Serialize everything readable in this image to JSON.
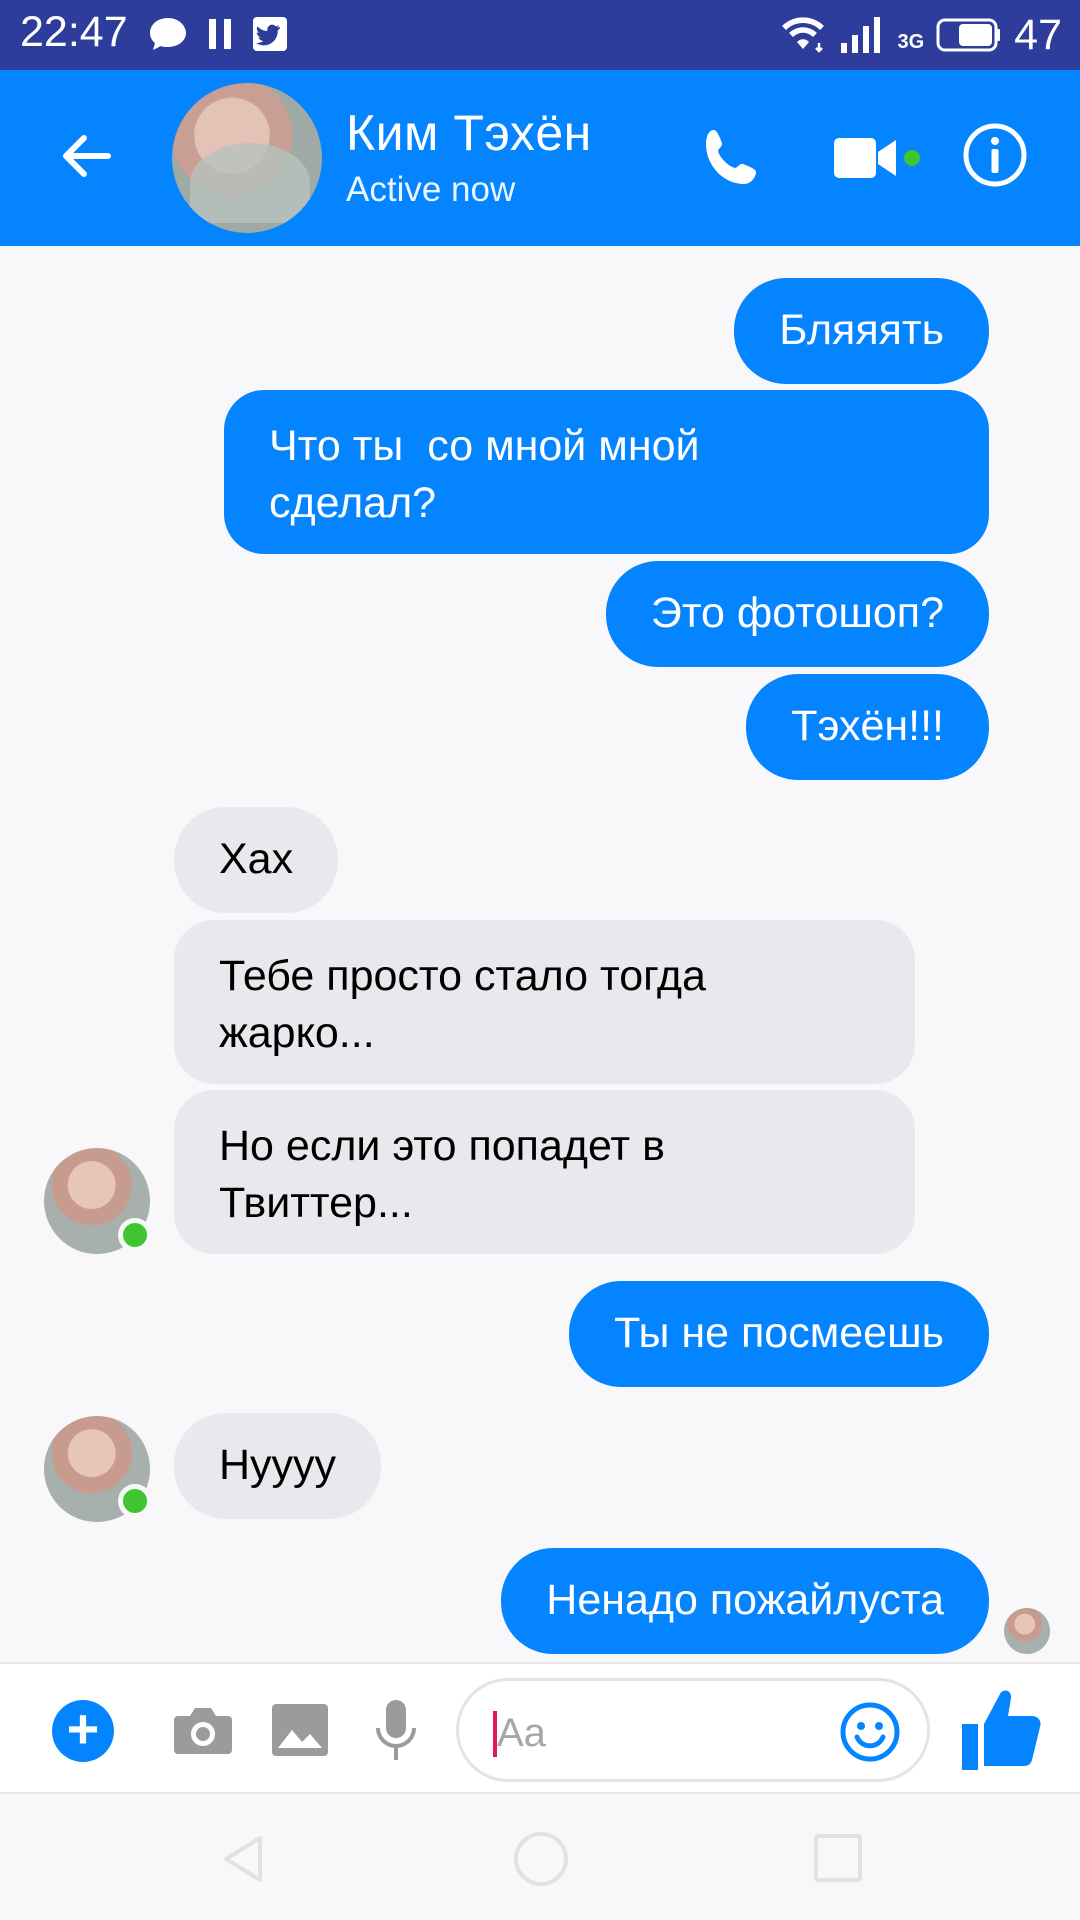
{
  "status_bar": {
    "time": "22:47",
    "network_label": "3G",
    "battery": "47",
    "icons": [
      "message-icon",
      "pause-icon",
      "twitter-icon",
      "wifi-icon",
      "signal-icon",
      "battery-icon"
    ]
  },
  "header": {
    "contact_name": "Ким Тэхён",
    "status": "Active now",
    "online_dot_color": "#3fc52f",
    "accent_color": "#0584ff",
    "icons": [
      "back-arrow-icon",
      "phone-icon",
      "video-camera-icon",
      "info-icon"
    ]
  },
  "messages": [
    {
      "direction": "out",
      "text": "Бляяять"
    },
    {
      "direction": "out",
      "text": "Что ты  со мной мной\nсделал?"
    },
    {
      "direction": "out",
      "text": "Это фотошоп?"
    },
    {
      "direction": "out",
      "text": "Тэхён!!!"
    },
    {
      "direction": "in",
      "text": "Хах"
    },
    {
      "direction": "in",
      "text": "Тебе просто стало тогда\nжарко..."
    },
    {
      "direction": "in",
      "text": "Но если это попадет в\nТвиттер..."
    },
    {
      "direction": "out",
      "text": "Ты не посмеешь"
    },
    {
      "direction": "in",
      "text": "Нуууу"
    },
    {
      "direction": "out",
      "text": "Ненадо пожайлуста"
    }
  ],
  "composer": {
    "placeholder": "Aa",
    "icons": [
      "plus-icon",
      "camera-icon",
      "image-icon",
      "microphone-icon",
      "emoji-icon",
      "thumbs-up-icon"
    ]
  },
  "nav": {
    "icons": [
      "nav-back-icon",
      "nav-home-icon",
      "nav-recent-icon"
    ]
  }
}
